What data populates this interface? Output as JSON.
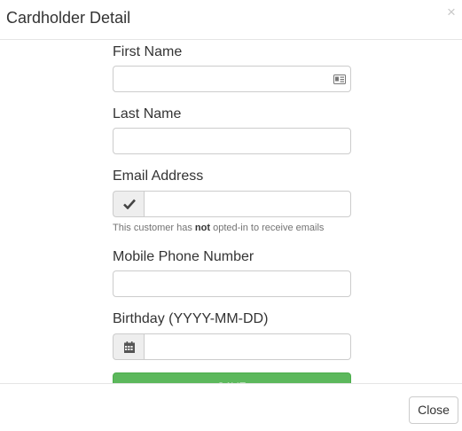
{
  "modal": {
    "title": "Cardholder Detail",
    "close_glyph": "×"
  },
  "form": {
    "first_name": {
      "label": "First Name",
      "value": "",
      "placeholder": ""
    },
    "last_name": {
      "label": "Last Name",
      "value": "",
      "placeholder": ""
    },
    "email": {
      "label": "Email Address",
      "value": "",
      "placeholder": "",
      "opt_in_checked": true,
      "help_prefix": "This customer has ",
      "help_emphasis": "not",
      "help_suffix": " opted-in to receive emails"
    },
    "mobile_phone": {
      "label": "Mobile Phone Number",
      "value": "",
      "placeholder": ""
    },
    "birthday": {
      "label": "Birthday (YYYY-MM-DD)",
      "value": "",
      "placeholder": ""
    },
    "save_label": "Save"
  },
  "footer": {
    "close_label": "Close"
  },
  "icons": {
    "close": "close-icon",
    "first_name_field": "id-card-icon",
    "email_addon": "checkmark-icon",
    "birthday_addon": "calendar-icon"
  },
  "colors": {
    "save_button": "#5cb85c",
    "addon_background": "#eeeeee",
    "input_border": "#cccccc"
  }
}
